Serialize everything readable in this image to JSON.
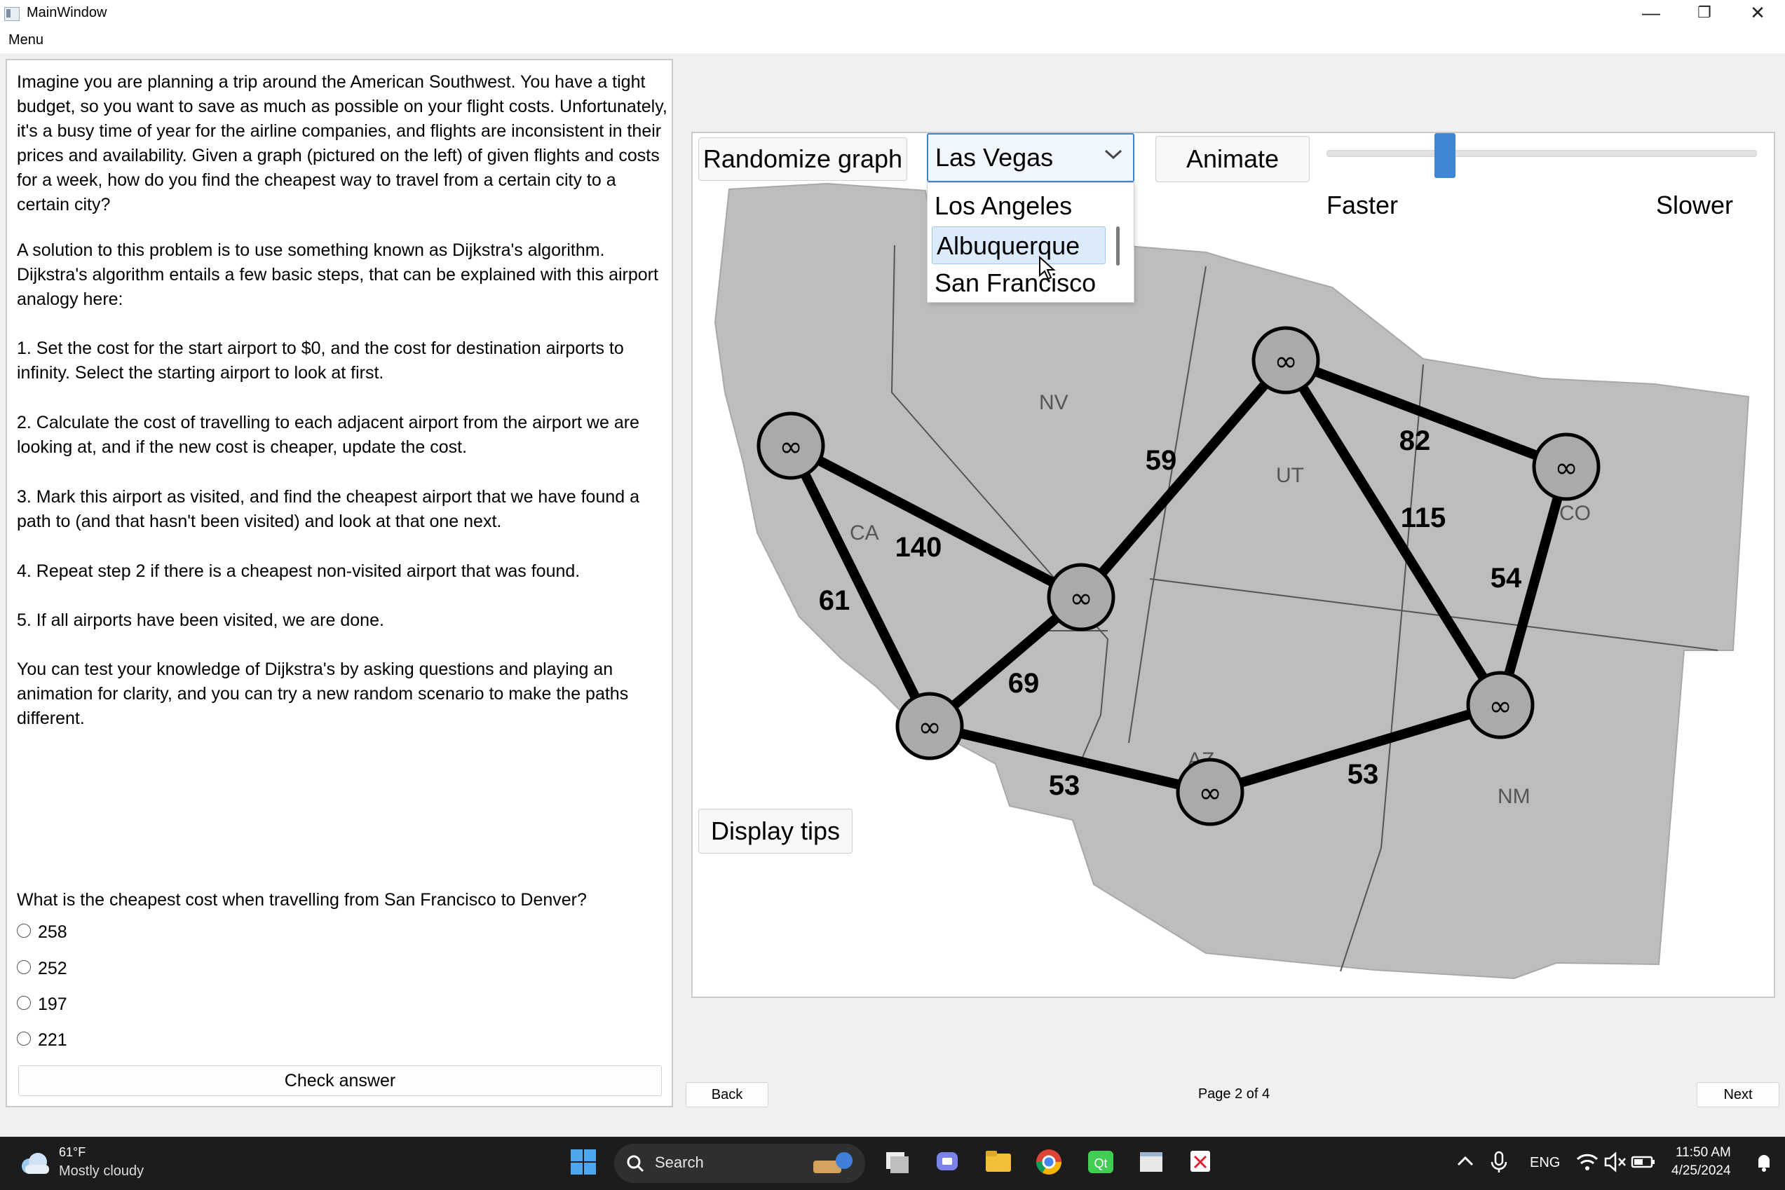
{
  "window": {
    "title": "MainWindow",
    "controls": {
      "minimize": "—",
      "maximize": "❐",
      "close": "✕"
    }
  },
  "menubar": {
    "menu_label": "Menu"
  },
  "left_panel": {
    "paragraphs": [
      "Imagine you are planning a trip around the American Southwest. You have a tight budget, so you want to save as much as possible on your flight costs. Unfortunately, it's a busy time of year for the airline companies, and flights are inconsistent in their prices and availability. Given a graph (pictured on the left) of given flights and costs for a week, how do you find the cheapest way to travel from a certain city to a certain city?",
      "A solution to this problem is to use something known as Dijkstra's algorithm. Dijkstra's algorithm entails a few basic steps, that can be explained with this airport analogy here:",
      "1. Set the cost for the start airport to $0, and the cost for destination airports to infinity. Select the starting airport to look at first.",
      "2. Calculate the cost of travelling to each adjacent airport from the airport we are looking at, and if the new cost is cheaper, update the cost.",
      "3. Mark this airport as visited, and find the cheapest airport that we have found a path to (and that hasn't been visited) and look at that one next.",
      "4. Repeat step 2 if there is a cheapest non-visited airport that was found.",
      "5. If all airports have been visited, we are done.",
      "You can test your knowledge of Dijkstra's by asking questions and playing an animation for clarity, and you can try a new random scenario to make the paths different."
    ],
    "question": "What is the cheapest cost when travelling from San Francisco to Denver?",
    "options": [
      "258",
      "252",
      "197",
      "221"
    ],
    "check_answer_label": "Check answer"
  },
  "toolbar": {
    "randomize_label": "Randomize graph",
    "selected_city": "Las Vegas",
    "dropdown_options": [
      "Los Angeles",
      "Albuquerque",
      "San Francisco"
    ],
    "highlighted_option": "Albuquerque",
    "animate_label": "Animate",
    "faster_label": "Faster",
    "slower_label": "Slower",
    "speed_slider_level": 0.27
  },
  "graph": {
    "node_symbol": "∞",
    "state_labels": [
      "NV",
      "UT",
      "CA",
      "CO",
      "AZ",
      "NM"
    ],
    "edge_costs": [
      "59",
      "82",
      "140",
      "115",
      "61",
      "54",
      "69",
      "53",
      "53"
    ],
    "display_tips_label": "Display tips"
  },
  "nav": {
    "back_label": "Back",
    "page_label": "Page 2 of 4",
    "next_label": "Next"
  },
  "taskbar": {
    "weather_temp": "61°F",
    "weather_desc": "Mostly cloudy",
    "search_label": "Search",
    "language": "ENG",
    "time": "11:50 AM",
    "date": "4/25/2024"
  }
}
